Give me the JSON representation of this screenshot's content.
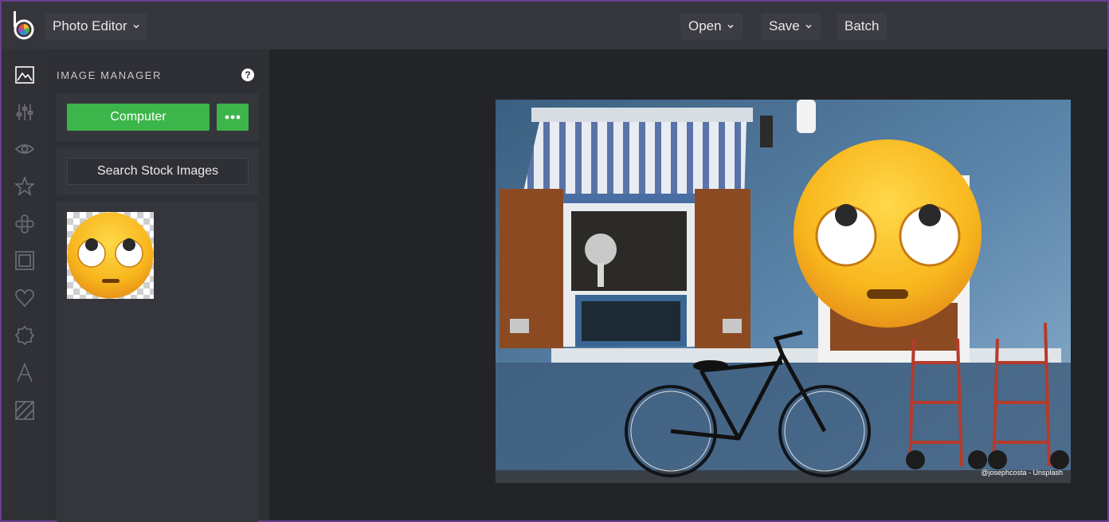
{
  "header": {
    "app_menu_label": "Photo Editor",
    "nav": [
      {
        "label": "Open"
      },
      {
        "label": "Save"
      },
      {
        "label": "Batch"
      }
    ]
  },
  "rail": {
    "items": [
      "image-icon",
      "sliders-icon",
      "eye-icon",
      "star-icon",
      "flower-icon",
      "frame-icon",
      "heart-icon",
      "badge-icon",
      "text-icon",
      "texture-icon"
    ]
  },
  "panel": {
    "title": "IMAGE MANAGER",
    "help_label": "?",
    "computer_button": "Computer",
    "search_button": "Search Stock Images"
  },
  "canvas": {
    "photo_credit": "@josephcosta - Unsplash"
  },
  "colors": {
    "accent_green": "#3cb54a",
    "topbar_bg": "#35363c",
    "panel_bg": "#2f3036",
    "canvas_bg": "#232428",
    "window_border": "#6a3d8f"
  }
}
